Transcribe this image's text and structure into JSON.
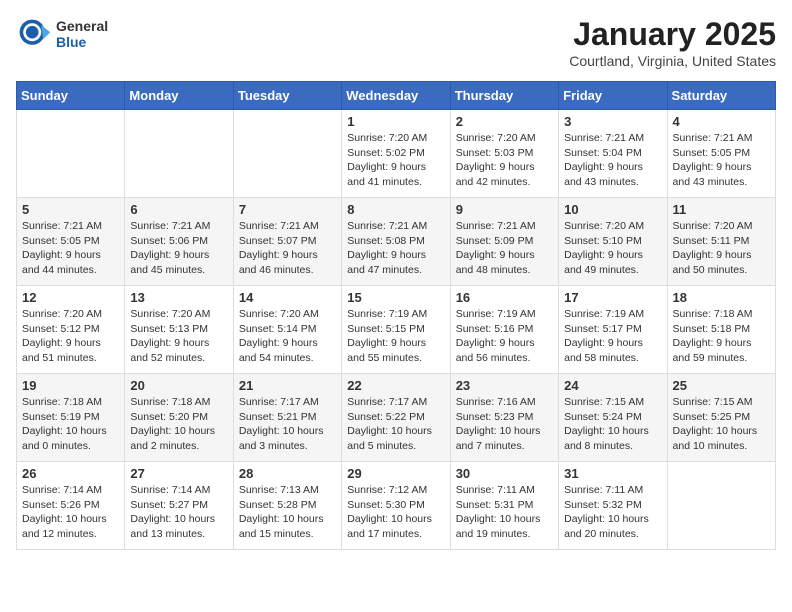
{
  "header": {
    "logo_general": "General",
    "logo_blue": "Blue",
    "month": "January 2025",
    "location": "Courtland, Virginia, United States"
  },
  "days_of_week": [
    "Sunday",
    "Monday",
    "Tuesday",
    "Wednesday",
    "Thursday",
    "Friday",
    "Saturday"
  ],
  "weeks": [
    [
      {
        "day": "",
        "content": ""
      },
      {
        "day": "",
        "content": ""
      },
      {
        "day": "",
        "content": ""
      },
      {
        "day": "1",
        "content": "Sunrise: 7:20 AM\nSunset: 5:02 PM\nDaylight: 9 hours and 41 minutes."
      },
      {
        "day": "2",
        "content": "Sunrise: 7:20 AM\nSunset: 5:03 PM\nDaylight: 9 hours and 42 minutes."
      },
      {
        "day": "3",
        "content": "Sunrise: 7:21 AM\nSunset: 5:04 PM\nDaylight: 9 hours and 43 minutes."
      },
      {
        "day": "4",
        "content": "Sunrise: 7:21 AM\nSunset: 5:05 PM\nDaylight: 9 hours and 43 minutes."
      }
    ],
    [
      {
        "day": "5",
        "content": "Sunrise: 7:21 AM\nSunset: 5:05 PM\nDaylight: 9 hours and 44 minutes."
      },
      {
        "day": "6",
        "content": "Sunrise: 7:21 AM\nSunset: 5:06 PM\nDaylight: 9 hours and 45 minutes."
      },
      {
        "day": "7",
        "content": "Sunrise: 7:21 AM\nSunset: 5:07 PM\nDaylight: 9 hours and 46 minutes."
      },
      {
        "day": "8",
        "content": "Sunrise: 7:21 AM\nSunset: 5:08 PM\nDaylight: 9 hours and 47 minutes."
      },
      {
        "day": "9",
        "content": "Sunrise: 7:21 AM\nSunset: 5:09 PM\nDaylight: 9 hours and 48 minutes."
      },
      {
        "day": "10",
        "content": "Sunrise: 7:20 AM\nSunset: 5:10 PM\nDaylight: 9 hours and 49 minutes."
      },
      {
        "day": "11",
        "content": "Sunrise: 7:20 AM\nSunset: 5:11 PM\nDaylight: 9 hours and 50 minutes."
      }
    ],
    [
      {
        "day": "12",
        "content": "Sunrise: 7:20 AM\nSunset: 5:12 PM\nDaylight: 9 hours and 51 minutes."
      },
      {
        "day": "13",
        "content": "Sunrise: 7:20 AM\nSunset: 5:13 PM\nDaylight: 9 hours and 52 minutes."
      },
      {
        "day": "14",
        "content": "Sunrise: 7:20 AM\nSunset: 5:14 PM\nDaylight: 9 hours and 54 minutes."
      },
      {
        "day": "15",
        "content": "Sunrise: 7:19 AM\nSunset: 5:15 PM\nDaylight: 9 hours and 55 minutes."
      },
      {
        "day": "16",
        "content": "Sunrise: 7:19 AM\nSunset: 5:16 PM\nDaylight: 9 hours and 56 minutes."
      },
      {
        "day": "17",
        "content": "Sunrise: 7:19 AM\nSunset: 5:17 PM\nDaylight: 9 hours and 58 minutes."
      },
      {
        "day": "18",
        "content": "Sunrise: 7:18 AM\nSunset: 5:18 PM\nDaylight: 9 hours and 59 minutes."
      }
    ],
    [
      {
        "day": "19",
        "content": "Sunrise: 7:18 AM\nSunset: 5:19 PM\nDaylight: 10 hours and 0 minutes."
      },
      {
        "day": "20",
        "content": "Sunrise: 7:18 AM\nSunset: 5:20 PM\nDaylight: 10 hours and 2 minutes."
      },
      {
        "day": "21",
        "content": "Sunrise: 7:17 AM\nSunset: 5:21 PM\nDaylight: 10 hours and 3 minutes."
      },
      {
        "day": "22",
        "content": "Sunrise: 7:17 AM\nSunset: 5:22 PM\nDaylight: 10 hours and 5 minutes."
      },
      {
        "day": "23",
        "content": "Sunrise: 7:16 AM\nSunset: 5:23 PM\nDaylight: 10 hours and 7 minutes."
      },
      {
        "day": "24",
        "content": "Sunrise: 7:15 AM\nSunset: 5:24 PM\nDaylight: 10 hours and 8 minutes."
      },
      {
        "day": "25",
        "content": "Sunrise: 7:15 AM\nSunset: 5:25 PM\nDaylight: 10 hours and 10 minutes."
      }
    ],
    [
      {
        "day": "26",
        "content": "Sunrise: 7:14 AM\nSunset: 5:26 PM\nDaylight: 10 hours and 12 minutes."
      },
      {
        "day": "27",
        "content": "Sunrise: 7:14 AM\nSunset: 5:27 PM\nDaylight: 10 hours and 13 minutes."
      },
      {
        "day": "28",
        "content": "Sunrise: 7:13 AM\nSunset: 5:28 PM\nDaylight: 10 hours and 15 minutes."
      },
      {
        "day": "29",
        "content": "Sunrise: 7:12 AM\nSunset: 5:30 PM\nDaylight: 10 hours and 17 minutes."
      },
      {
        "day": "30",
        "content": "Sunrise: 7:11 AM\nSunset: 5:31 PM\nDaylight: 10 hours and 19 minutes."
      },
      {
        "day": "31",
        "content": "Sunrise: 7:11 AM\nSunset: 5:32 PM\nDaylight: 10 hours and 20 minutes."
      },
      {
        "day": "",
        "content": ""
      }
    ]
  ]
}
